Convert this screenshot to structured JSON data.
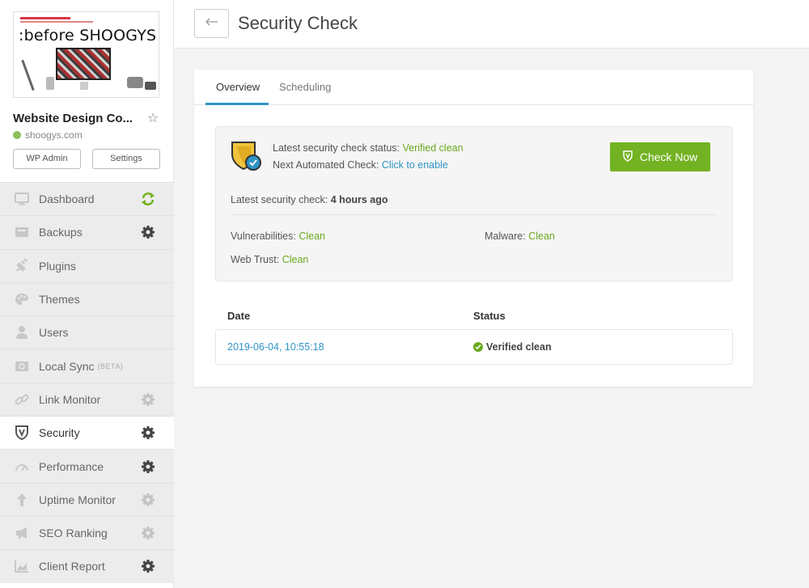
{
  "site": {
    "thumbnail_text": ":before SHOOGYS",
    "title": "Website Design Co...",
    "url": "shoogys.com",
    "wp_admin_label": "WP Admin",
    "settings_label": "Settings"
  },
  "menu": [
    {
      "label": "Dashboard",
      "icon": "monitor-icon",
      "right_icon": "sync-icon"
    },
    {
      "label": "Backups",
      "icon": "backup-icon",
      "right_icon": "gear-icon"
    },
    {
      "label": "Plugins",
      "icon": "plug-icon",
      "right_icon": ""
    },
    {
      "label": "Themes",
      "icon": "palette-icon",
      "right_icon": ""
    },
    {
      "label": "Users",
      "icon": "user-icon",
      "right_icon": ""
    },
    {
      "label": "Local Sync",
      "badge": "(BETA)",
      "icon": "sync-folder-icon",
      "right_icon": ""
    },
    {
      "label": "Link Monitor",
      "icon": "link-icon",
      "right_icon": "gear-icon"
    },
    {
      "label": "Security",
      "icon": "shield-icon",
      "right_icon": "gear-icon",
      "active": true
    },
    {
      "label": "Performance",
      "icon": "gauge-icon",
      "right_icon": "gear-icon"
    },
    {
      "label": "Uptime Monitor",
      "icon": "arrow-up-icon",
      "right_icon": "gear-icon"
    },
    {
      "label": "SEO Ranking",
      "icon": "megaphone-icon",
      "right_icon": "gear-icon"
    },
    {
      "label": "Client Report",
      "icon": "chart-icon",
      "right_icon": "gear-icon"
    }
  ],
  "header": {
    "title": "Security Check"
  },
  "tabs": {
    "overview": "Overview",
    "scheduling": "Scheduling"
  },
  "status": {
    "latest_status_label": "Latest security check status:",
    "latest_status_value": "Verified clean",
    "next_check_label": "Next Automated Check:",
    "next_check_value": "Click to enable",
    "check_now_label": "Check Now",
    "latest_check_label": "Latest security check:",
    "latest_check_value": "4 hours ago",
    "vulnerabilities_label": "Vulnerabilities:",
    "vulnerabilities_value": "Clean",
    "malware_label": "Malware:",
    "malware_value": "Clean",
    "web_trust_label": "Web Trust:",
    "web_trust_value": "Clean"
  },
  "history": {
    "headers": [
      "Date",
      "Status"
    ],
    "rows": [
      {
        "date": "2019-06-04, 10:55:18",
        "status": "Verified clean"
      }
    ]
  },
  "colors": {
    "accent_green": "#73b222",
    "link_blue": "#2f94c6"
  }
}
